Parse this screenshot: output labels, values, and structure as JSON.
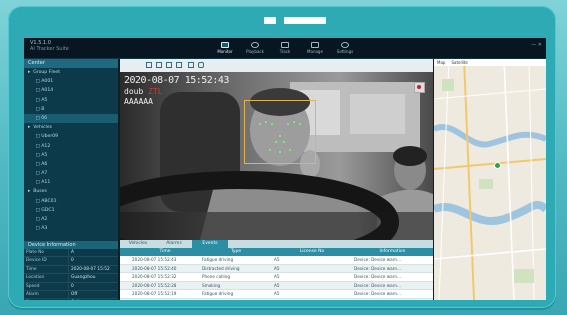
{
  "app": {
    "brand_line1": "V1.5.1.0",
    "brand_line2": "AI Tracker Suite"
  },
  "nav": {
    "tabs": [
      {
        "label": "Monitor",
        "icon": "monitor-icon",
        "active": true
      },
      {
        "label": "Playback",
        "icon": "playback-icon",
        "active": false
      },
      {
        "label": "Track",
        "icon": "track-icon",
        "active": false
      },
      {
        "label": "Manage",
        "icon": "manage-icon",
        "active": false
      },
      {
        "label": "Settings",
        "icon": "gear-icon",
        "active": false
      }
    ]
  },
  "tree": {
    "header": "Center",
    "items": [
      "▸  Group Fleet",
      "   □ A001",
      "   □ A014",
      "   □ A5",
      "   □ B",
      "   □ 06",
      "▸  Vehicles",
      "   □ Uber09",
      "   □ A12",
      "   □ A5",
      "   □ A6",
      "   □ A7",
      "   □ A11",
      "▸  Buses",
      "   □ ABC01",
      "   □ GDC1",
      "   □ A2",
      "   □ A3"
    ],
    "selected_index": 5
  },
  "device_info": {
    "title": "Device Information",
    "rows": [
      {
        "k": "Plate No",
        "v": "A"
      },
      {
        "k": "Device ID",
        "v": "0"
      },
      {
        "k": "Time",
        "v": "2020-08-07 15:52"
      },
      {
        "k": "Location",
        "v": "Guangzhou"
      },
      {
        "k": "Speed",
        "v": "0"
      },
      {
        "k": "Alarm",
        "v": "Off"
      },
      {
        "k": "Status",
        "v": "Online"
      }
    ]
  },
  "video": {
    "date_overlay": "2020-08-07 15:52:43",
    "plate_prefix": "doub",
    "plate_red": "ZTL",
    "code_overlay": "AAAAAA"
  },
  "map": {
    "tab1": "Map",
    "tab2": "Satellite"
  },
  "events": {
    "tabs": [
      {
        "label": "Vehicles",
        "active": false
      },
      {
        "label": "Alarms",
        "active": false
      },
      {
        "label": "Events",
        "active": true
      }
    ],
    "columns": [
      "Time",
      "Type",
      "License No",
      "Information"
    ],
    "rows": [
      [
        "2020-08-07 15:52:43",
        "Fatigue driving",
        "A5",
        "Device: Device warn..."
      ],
      [
        "2020-08-07 15:52:40",
        "Distracted driving",
        "A5",
        "Device: Device warn..."
      ],
      [
        "2020-08-07 15:52:32",
        "Phone calling",
        "A5",
        "Device: Device warn..."
      ],
      [
        "2020-08-07 15:52:28",
        "Smoking",
        "A5",
        "Device: Device warn..."
      ],
      [
        "2020-08-07 15:52:19",
        "Fatigue driving",
        "A5",
        "Device: Device warn..."
      ],
      [
        "2020-08-07 15:52:11",
        "Distracted driving",
        "A5",
        "Device: Device warn..."
      ]
    ]
  }
}
